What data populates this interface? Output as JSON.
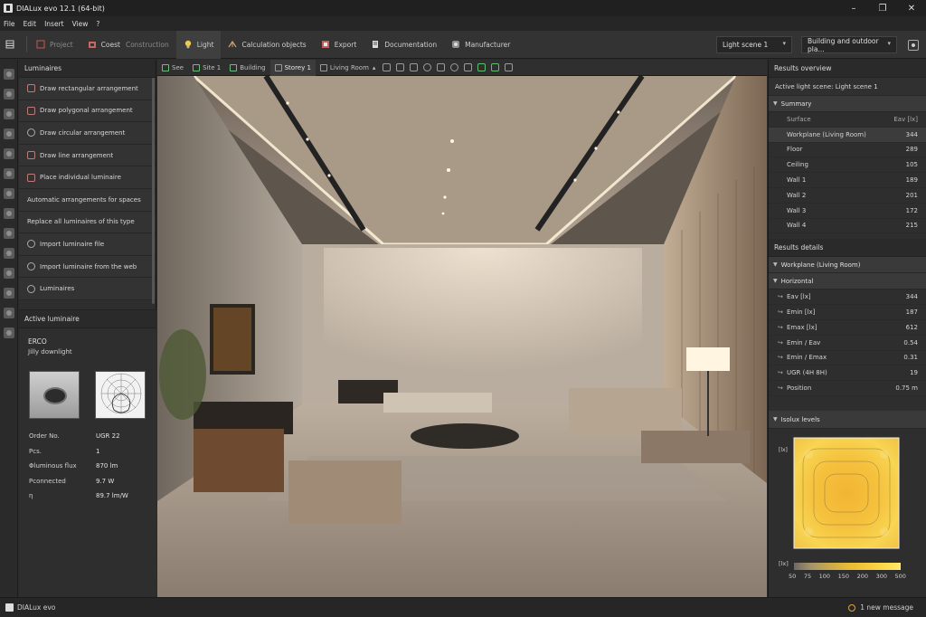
{
  "window": {
    "title": "DIALux evo 12.1 (64-bit)",
    "minimize": "–",
    "maximize": "❐",
    "close": "✕"
  },
  "menu": [
    "File",
    "Edit",
    "Insert",
    "View",
    "?"
  ],
  "toolbar": {
    "items": [
      {
        "label": "Project",
        "icon": "project-icon",
        "color": "#b5524e",
        "dim": true
      },
      {
        "label": "Construction",
        "prefix": "Coest",
        "icon": "construction-icon",
        "color": "#c46a63",
        "dim": false
      },
      {
        "label": "Light",
        "icon": "bulb-icon",
        "color": "#f0c84a",
        "active": true
      },
      {
        "label": "Calculation objects",
        "icon": "calc-objects-icon",
        "color": "#c9a36b"
      },
      {
        "label": "Export",
        "icon": "export-icon",
        "color": "#c0605d"
      },
      {
        "label": "Documentation",
        "icon": "documentation-icon",
        "color": "#cfcfcf"
      },
      {
        "label": "Manufacturer",
        "icon": "manufacturer-icon",
        "color": "#bdbdbd"
      }
    ],
    "light_scene": "Light scene 1",
    "view_mode": "Building and outdoor pla..."
  },
  "left_panel": {
    "title": "Luminaires",
    "items": [
      {
        "label": "Draw rectangular arrangement",
        "icon": "rect-arrangement-icon"
      },
      {
        "label": "Draw polygonal arrangement",
        "icon": "polygon-arrangement-icon"
      },
      {
        "label": "Draw circular arrangement",
        "icon": "circle-arrangement-icon"
      },
      {
        "label": "Draw line arrangement",
        "icon": "line-arrangement-icon"
      },
      {
        "label": "Place individual luminaire",
        "icon": "luminaire-icon"
      },
      {
        "label": "Automatic arrangements for spaces",
        "icon": ""
      },
      {
        "label": "Replace all luminaires of this type",
        "icon": ""
      },
      {
        "label": "Import luminaire file",
        "icon": "import-file-icon"
      },
      {
        "label": "Import luminaire from the web",
        "icon": "web-icon"
      },
      {
        "label": "Luminaires",
        "icon": "luminaires-icon"
      }
    ],
    "active": {
      "title": "Active luminaire",
      "brand": "ERCO",
      "model": "Jilly downlight",
      "props": [
        {
          "k": "Order No.",
          "v": "UGR 22"
        },
        {
          "k": "Pcs.",
          "v": "1"
        },
        {
          "k": "Φluminous flux",
          "v": "870 lm"
        },
        {
          "k": "Pconnected",
          "v": "9.7 W"
        },
        {
          "k": "η",
          "v": "89.7 lm/W"
        }
      ]
    }
  },
  "view_tabs": {
    "tabs": [
      "See",
      "Site 1",
      "Building",
      "Storey 1",
      "Living Room"
    ]
  },
  "results": {
    "overview_title": "Results overview",
    "active_scene": "Active light scene:  Light scene 1",
    "summary_title": "Summary",
    "summary_header": {
      "k": "Surface",
      "v": "Eav [lx]"
    },
    "summary": [
      {
        "k": "Workplane (Living Room)",
        "v": "344"
      },
      {
        "k": "Floor",
        "v": "289"
      },
      {
        "k": "Ceiling",
        "v": "105"
      },
      {
        "k": "Wall 1",
        "v": "189"
      },
      {
        "k": "Wall 2",
        "v": "201"
      },
      {
        "k": "Wall 3",
        "v": "172"
      },
      {
        "k": "Wall 4",
        "v": "215"
      }
    ],
    "details_title": "Results details",
    "workplane": "Workplane (Living Room)",
    "horizontal": "Horizontal",
    "details": [
      {
        "k": "Eav [lx]",
        "v": "344"
      },
      {
        "k": "Emin [lx]",
        "v": "187"
      },
      {
        "k": "Emax [lx]",
        "v": "612"
      },
      {
        "k": "Emin / Eav",
        "v": "0.54"
      },
      {
        "k": "Emin / Emax",
        "v": "0.31"
      },
      {
        "k": "UGR (4H 8H)",
        "v": "19"
      },
      {
        "k": "Position",
        "v": "0.75 m"
      }
    ],
    "isolux_title": "Isolux levels",
    "legend_unit": "[lx]",
    "axis_unit": "[lx]",
    "legend": [
      "50",
      "75",
      "100",
      "150",
      "200",
      "300",
      "500"
    ]
  },
  "status": {
    "app": "DIALux evo",
    "messages": "1 new message"
  },
  "colors": {
    "accent": "#f0c84a",
    "panel": "#2e2e2e",
    "bg": "#2b2b2b"
  }
}
